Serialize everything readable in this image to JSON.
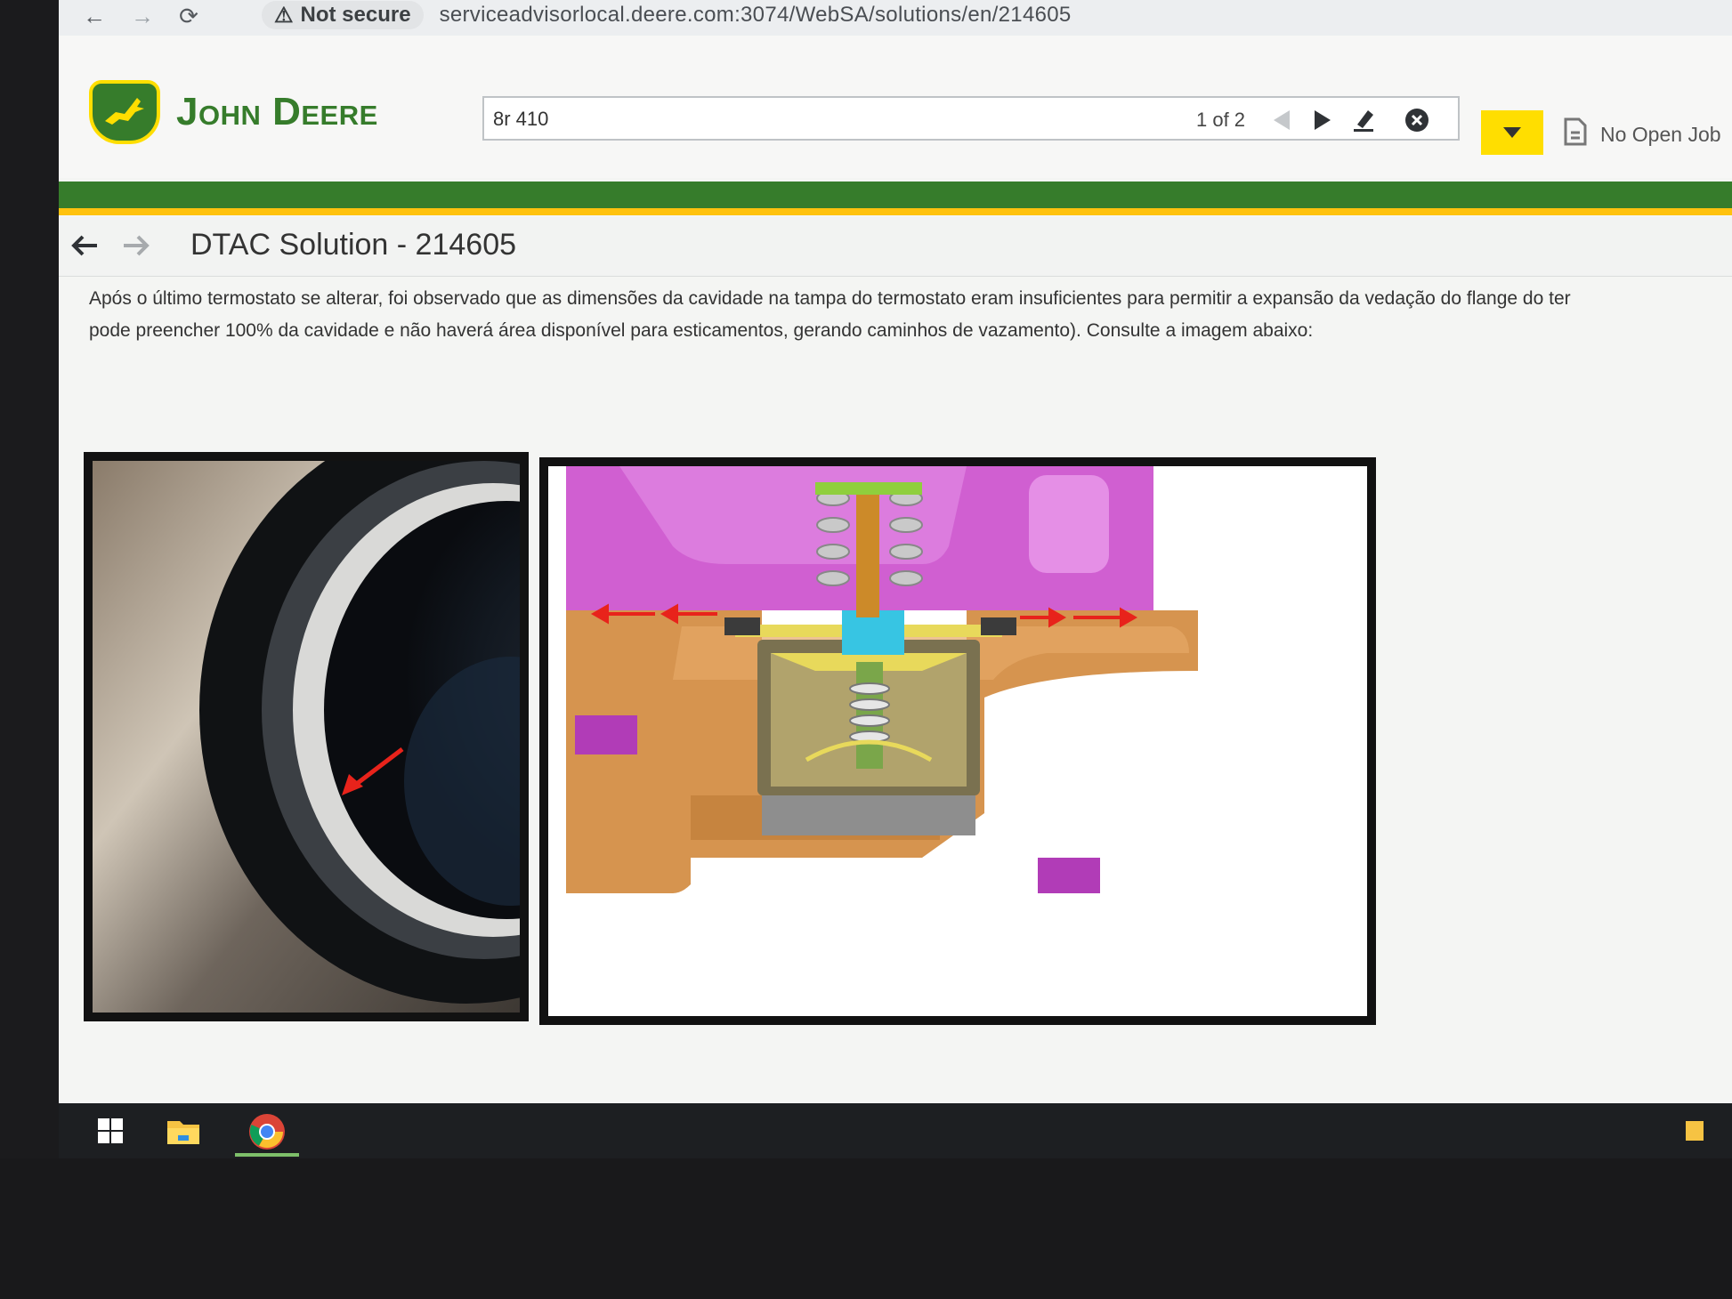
{
  "browser": {
    "security_label": "Not secure",
    "url": "serviceadvisorlocal.deere.com:3074/WebSA/solutions/en/214605"
  },
  "app": {
    "brand": "John Deere",
    "search_value": "8r 410",
    "match_count": "1 of 2",
    "job_status": "No Open Job"
  },
  "page": {
    "title": "DTAC Solution - 214605",
    "paragraph_line1": "Após o último termostato se alterar, foi observado que as dimensões da cavidade na tampa do termostato eram insuficientes para permitir a expansão da vedação do flange do ter",
    "paragraph_line2": "pode preencher 100% da cavidade e não haverá área disponível para esticamentos, gerando caminhos de vazamento). Consulte a imagem abaixo:"
  },
  "colors": {
    "brand_green": "#367c2b",
    "brand_yellow": "#ffde00",
    "stripe_yellow": "#ffc20e",
    "arrow_red": "#e8231b"
  },
  "icons": {
    "back": "arrow-left-icon",
    "forward": "arrow-right-icon",
    "reload": "reload-icon",
    "warning": "warning-icon",
    "prev": "triangle-left-icon",
    "next": "triangle-right-icon",
    "clear": "close-circle-icon",
    "highlight": "highlighter-icon",
    "dropdown": "chevron-down-icon",
    "job": "document-icon"
  }
}
